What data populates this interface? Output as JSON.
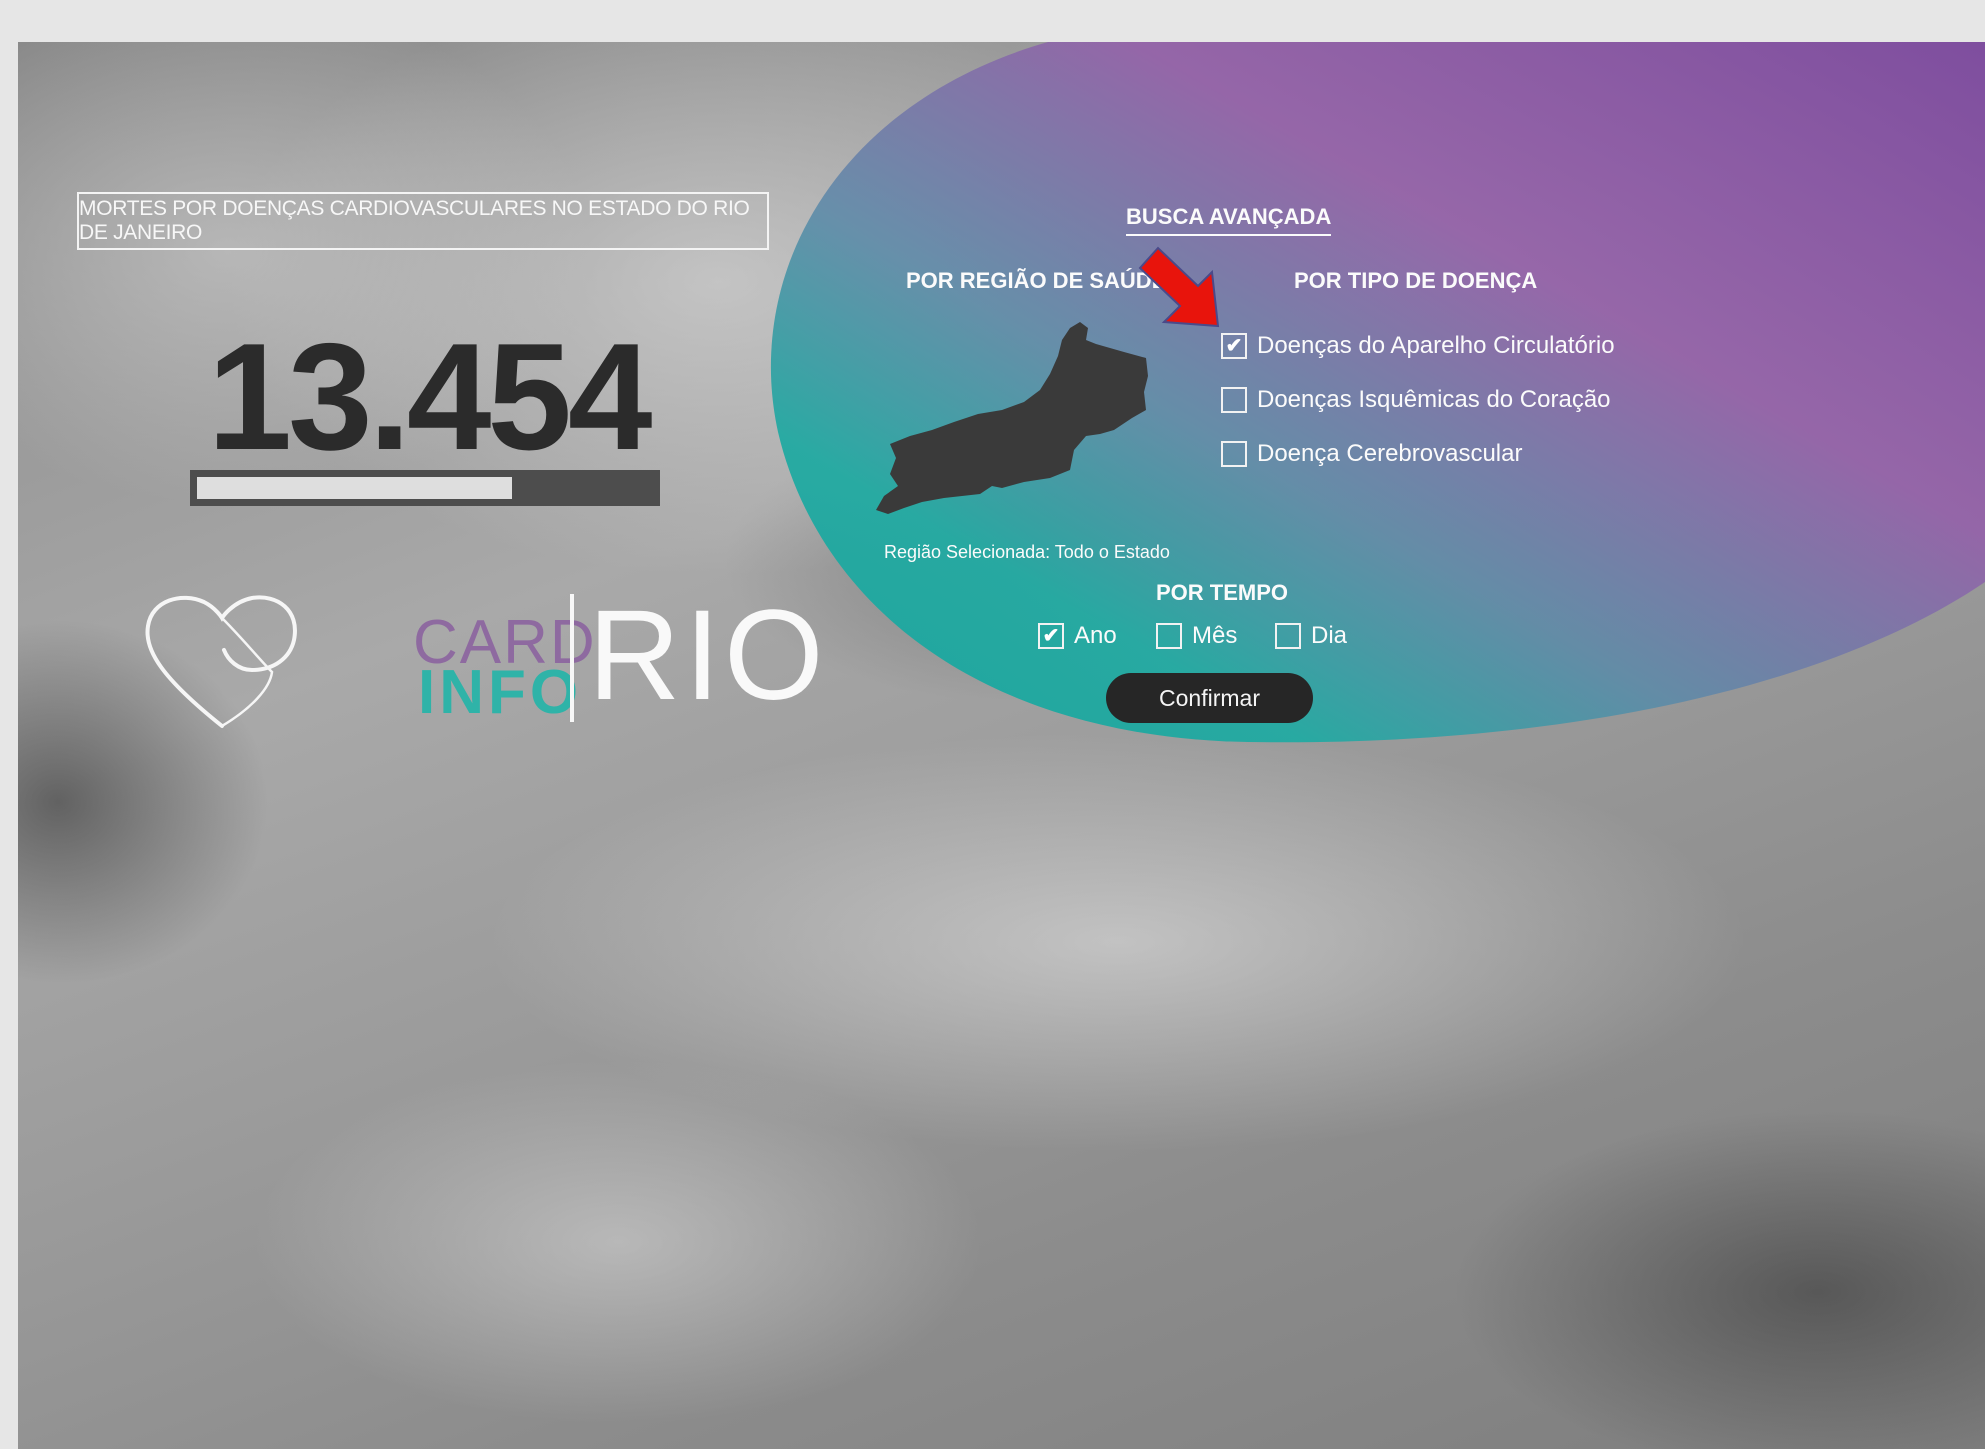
{
  "header": {
    "title": "MORTES POR DOENÇAS CARDIOVASCULARES NO ESTADO DO RIO DE JANEIRO"
  },
  "stats": {
    "total_deaths": "13.454",
    "progress_fraction": 0.69
  },
  "logo": {
    "card": "CARD",
    "info": "INFO",
    "rio": "RIO"
  },
  "advanced_search": {
    "title": "BUSCA AVANÇADA",
    "region_heading": "POR REGIÃO DE SAÚDE",
    "disease_heading": "POR TIPO DE DOENÇA",
    "selected_region": "Região Selecionada: Todo o Estado",
    "disease_options": [
      {
        "label": "Doenças do Aparelho Circulatório",
        "checked": true
      },
      {
        "label": "Doenças Isquêmicas do Coração",
        "checked": false
      },
      {
        "label": "Doença Cerebrovascular",
        "checked": false
      }
    ],
    "time_heading": "POR TEMPO",
    "time_options": [
      {
        "label": "Ano",
        "checked": true
      },
      {
        "label": "Mês",
        "checked": false
      },
      {
        "label": "Dia",
        "checked": false
      }
    ],
    "confirm_label": "Confirmar"
  },
  "icons": {
    "check": "✔",
    "annotation": "red-arrow-icon"
  },
  "colors": {
    "purple": "#8e5aa6",
    "teal": "#2fb3a8",
    "dark": "#262626",
    "annotation_red": "#e8140c"
  }
}
